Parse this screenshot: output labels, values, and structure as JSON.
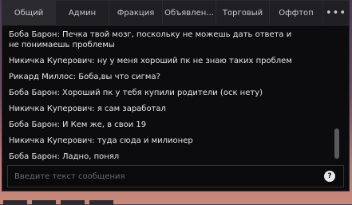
{
  "tabs": [
    {
      "label": "Общий"
    },
    {
      "label": "Админ"
    },
    {
      "label": "Фракция"
    },
    {
      "label": "Объявлен..."
    },
    {
      "label": "Торговый"
    },
    {
      "label": "Оффтоп"
    },
    {
      "label": "•••"
    }
  ],
  "messages": [
    {
      "text": "Боба Барон: Печка твой мозг, поскольку не можешь дать ответа и\nне понимаешь проблемы"
    },
    {
      "text": "Никичка Куперович: ну у меня хороший пк не знаю таких проблем"
    },
    {
      "text": "Рикард Миллос: Боба,вы что сигма?"
    },
    {
      "text": "Боба Барон: Хороший пк у тебя купили родители (оск нету)"
    },
    {
      "text": "Никичка Куперович: я сам заработал"
    },
    {
      "text": "Боба Барон: И Кем же, в свои 19"
    },
    {
      "text": "Никичка Куперович: туда сюда и милионер"
    },
    {
      "text": "Боба Барон: Ладно, понял"
    }
  ],
  "input": {
    "placeholder": "Введите текст сообщения",
    "value": ""
  },
  "help_label": "?",
  "scroll_position": 1.0
}
